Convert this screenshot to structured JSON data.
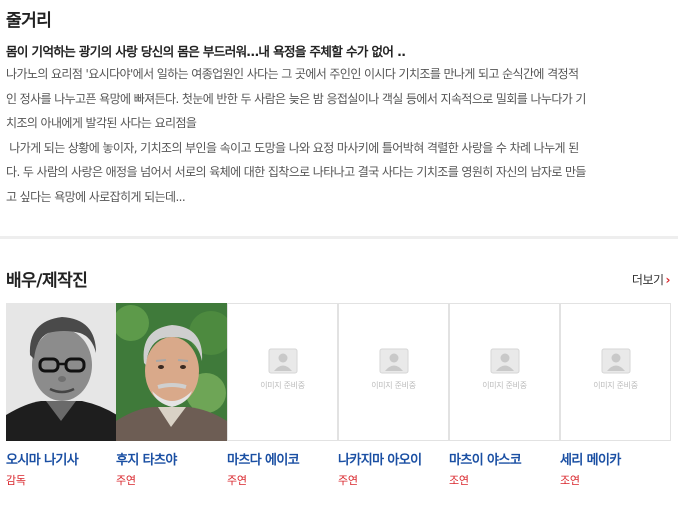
{
  "synopsis": {
    "title": "줄거리",
    "headline": "몸이 기억하는 광기의 사랑 당신의 몸은 부드러워…내 욕정을 주체할 수가 없어 ..",
    "lines": [
      "나가노의 요리점 '요시다야'에서 일하는 여종업원인 사다는 그 곳에서 주인인 이시다 기치조를 만나게 되고 순식간에 격정적",
      "인 정사를 나누고픈 욕망에 빠져든다. 첫눈에 반한 두 사람은 늦은 밤 응접실이나 객실 등에서 지속적으로 밀회를 나누다가 기",
      "치조의 아내에게 발각된 사다는 요리점을",
      " 나가게 되는 상황에 놓이자, 기치조의 부인을 속이고 도망을 나와 요정 마사키에 틀어박혀 격렬한 사랑을 수 차례 나누게 된",
      "다. 두 사람의 사랑은 애정을 넘어서 서로의 육체에 대한 집착으로 나타나고 결국 사다는 기치조를 영원히 자신의 남자로 만들",
      "고 싶다는 욕망에 사로잡히게 되는데..."
    ]
  },
  "cast": {
    "title": "배우/제작진",
    "more_label": "더보기",
    "more_icon": "chevron-right-icon",
    "placeholder_text": "이미지 준비중",
    "accent_color": "#d9262c",
    "name_color": "#1a4fa3",
    "members": [
      {
        "name": "오시마 나기사",
        "role": "감독",
        "photo": "photo"
      },
      {
        "name": "후지 타츠야",
        "role": "주연",
        "photo": "photo"
      },
      {
        "name": "마츠다 에이코",
        "role": "주연",
        "photo": "placeholder"
      },
      {
        "name": "나카지마 아오이",
        "role": "주연",
        "photo": "placeholder"
      },
      {
        "name": "마츠이 야스코",
        "role": "조연",
        "photo": "placeholder"
      },
      {
        "name": "세리 메이카",
        "role": "조연",
        "photo": "placeholder"
      }
    ]
  }
}
